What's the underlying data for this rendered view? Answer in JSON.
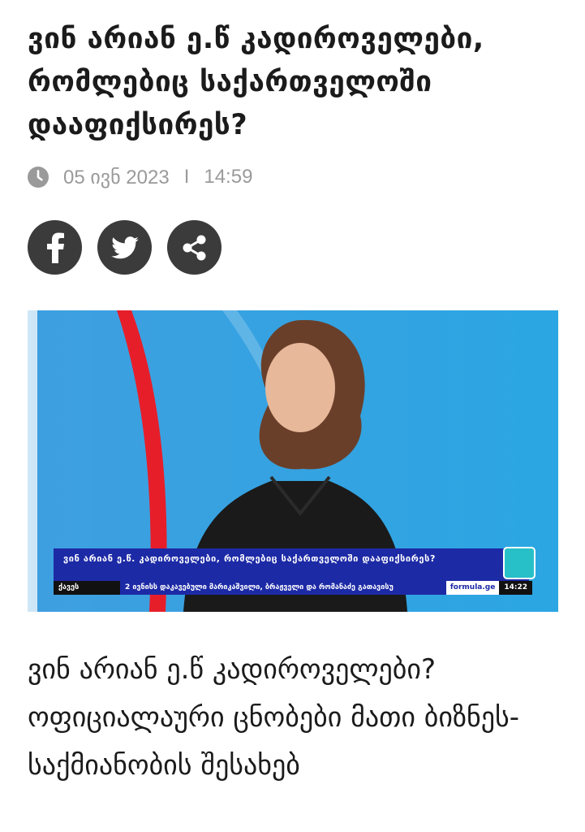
{
  "article": {
    "title": "ვინ არიან ე.წ კადიროველები, რომლებიც საქართველოში დააფიქსირეს?",
    "date": "05 ივნ 2023",
    "separator": "I",
    "time": "14:59",
    "caption": "ვინ არიან ე.წ კადიროველები? ოფიციალაური ცნობები მათი ბიზნეს-საქმიანობის შესახებ"
  },
  "share": {
    "buttons": [
      {
        "icon": "facebook-icon"
      },
      {
        "icon": "twitter-icon"
      },
      {
        "icon": "share-icon"
      }
    ]
  },
  "video": {
    "lower_third": "ვინ არიან ე.წ. კადიროველები, რომლებიც საქართველოში დააფიქსირეს?",
    "ticker_label": "ქავეს",
    "ticker_text": "2 ივნისს დაკავებული მარიკაშვილი, ბრაჟველი და რომანაძე გათავისუ",
    "site": "formula.ge",
    "clock": "14:22"
  },
  "colors": {
    "text": "#1b1b1b",
    "meta": "#9a9a9a",
    "share_bg": "#3b3b3b",
    "studio_blue": "#2ea3e0",
    "ticker_blue": "#1d2aa6"
  }
}
